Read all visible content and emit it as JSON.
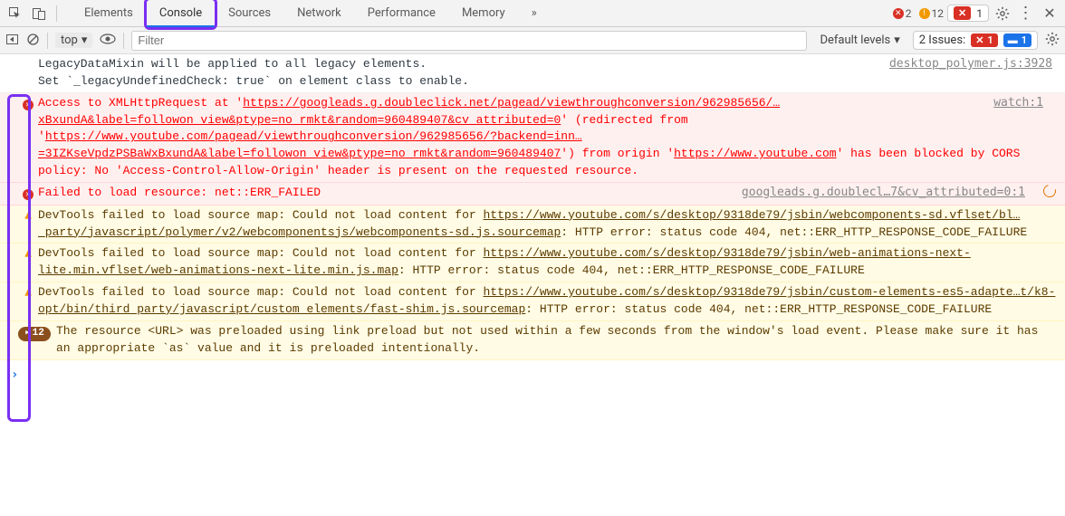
{
  "tabbar": {
    "tabs": [
      {
        "label": "Elements"
      },
      {
        "label": "Console"
      },
      {
        "label": "Sources"
      },
      {
        "label": "Network"
      },
      {
        "label": "Performance"
      },
      {
        "label": "Memory"
      }
    ],
    "more": "»",
    "error_count": "2",
    "warn_count": "12",
    "hidden_error_count": "1"
  },
  "toolbar": {
    "context": "top",
    "filter_placeholder": "Filter",
    "levels": "Default levels",
    "issues_label": "2 Issues:",
    "issue_err_count": "1",
    "issue_info_count": "1"
  },
  "messages": {
    "log1_line1": "LegacyDataMixin will be applied to all legacy elements.",
    "log1_line2": "Set `_legacyUndefinedCheck: true` on element class to enable.",
    "log1_source": "desktop_polymer.js:3928",
    "err1_pre": "Access to XMLHttpRequest at '",
    "err1_url1": "https://googleads.g.doubleclick.net/pagead/viewthroughconversion/962985656/…xBxundA&label=followon_view&ptype=no_rmkt&random=960489407&cv_attributed=0",
    "err1_mid1": "' (redirected from '",
    "err1_url2": "https://www.youtube.com/pagead/viewthroughconversion/962985656/?backend=inn…=3IZKseVpdzPSBaWxBxundA&label=followon_view&ptype=no_rmkt&random=960489407",
    "err1_mid2": "') from origin '",
    "err1_url3": "https://www.youtube.com",
    "err1_tail": "' has been blocked by CORS policy: No 'Access-Control-Allow-Origin' header is present on the requested resource.",
    "err1_source": "watch:1",
    "err2_text": "Failed to load resource: net::ERR_FAILED",
    "err2_source": "googleads.g.doublecl…7&cv_attributed=0:1",
    "warn1_pre": "DevTools failed to load source map: Could not load content for ",
    "warn1_url": "https://www.youtube.com/s/desktop/9318de79/jsbin/webcomponents-sd.vflset/bl…_party/javascript/polymer/v2/webcomponentsjs/webcomponents-sd.js.sourcemap",
    "warn1_tail": ": HTTP error: status code 404, net::ERR_HTTP_RESPONSE_CODE_FAILURE",
    "warn2_pre": "DevTools failed to load source map: Could not load content for ",
    "warn2_url": "https://www.youtube.com/s/desktop/9318de79/jsbin/web-animations-next-lite.min.vflset/web-animations-next-lite.min.js.map",
    "warn2_tail": ": HTTP error: status code 404, net::ERR_HTTP_RESPONSE_CODE_FAILURE",
    "warn3_pre": "DevTools failed to load source map: Could not load content for ",
    "warn3_url": "https://www.youtube.com/s/desktop/9318de79/jsbin/custom-elements-es5-adapte…t/k8-opt/bin/third_party/javascript/custom_elements/fast-shim.js.sourcemap",
    "warn3_tail": ": HTTP error: status code 404, net::ERR_HTTP_RESPONSE_CODE_FAILURE",
    "warn4_count": "12",
    "warn4_text": "The resource <URL> was preloaded using link preload but not used within a few seconds from the window's load event. Please make sure it has an appropriate `as` value and it is preloaded intentionally."
  },
  "prompt": "›"
}
